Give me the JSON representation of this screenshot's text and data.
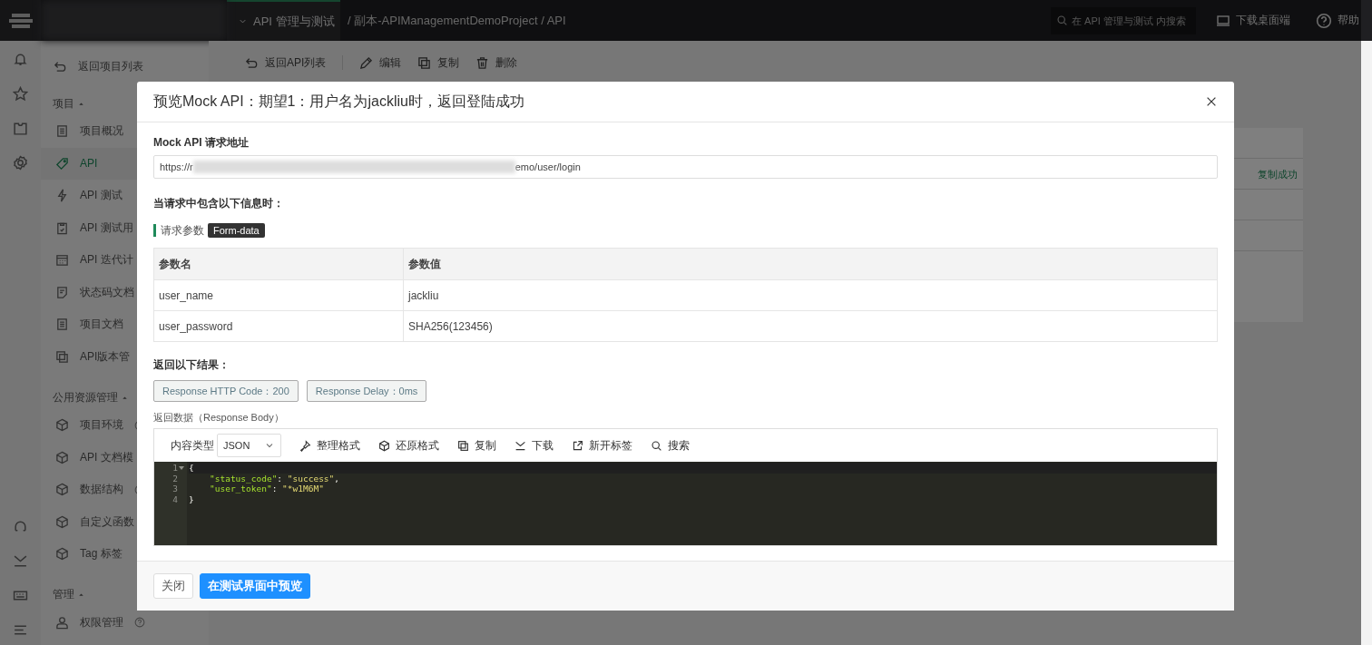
{
  "topbar": {
    "project_dropdown": "API 管理与测试",
    "breadcrumb": "/ 副本-APIManagementDemoProject / API",
    "search": {
      "placeholder": "在 API 管理与测试 内搜索"
    },
    "download": "下载桌面端",
    "help": "帮助"
  },
  "rail": [
    {
      "kind": "bell"
    },
    {
      "kind": "star"
    },
    {
      "kind": "shirt"
    },
    {
      "kind": "gear"
    }
  ],
  "rail_bottom": [
    {
      "kind": "headset"
    },
    {
      "kind": "download"
    },
    {
      "kind": "keyboard"
    },
    {
      "kind": "menu"
    }
  ],
  "sidebar": {
    "back": "返回项目列表",
    "groups": [
      {
        "title": "项目",
        "expanded": true,
        "items": [
          {
            "label": "项目概况",
            "kind": "doc",
            "selected": false,
            "info": false
          },
          {
            "label": "API",
            "kind": "tag",
            "selected": true,
            "info": false
          },
          {
            "label": "API 测试",
            "kind": "bolt",
            "selected": false,
            "info": false
          },
          {
            "label": "API 测试用",
            "kind": "clip",
            "selected": false,
            "info": false
          },
          {
            "label": "API 迭代计",
            "kind": "calendar",
            "selected": false,
            "info": false
          },
          {
            "label": "状态码文档",
            "kind": "note",
            "selected": false,
            "info": false
          },
          {
            "label": "项目文档",
            "kind": "doc",
            "selected": false,
            "info": false
          },
          {
            "label": "API版本管",
            "kind": "copy",
            "selected": false,
            "info": false
          }
        ]
      },
      {
        "title": "公用资源管理",
        "expanded": true,
        "items": [
          {
            "label": "项目环境",
            "kind": "cube",
            "selected": false,
            "info": true
          },
          {
            "label": "API 文档模",
            "kind": "cube",
            "selected": false,
            "info": false
          },
          {
            "label": "数据结构",
            "kind": "cube",
            "selected": false,
            "info": true
          },
          {
            "label": "自定义函数",
            "kind": "cube",
            "selected": false,
            "info": false
          },
          {
            "label": "Tag 标签",
            "kind": "cube",
            "selected": false,
            "info": false
          }
        ]
      },
      {
        "title": "管理",
        "expanded": true,
        "items": [
          {
            "label": "权限管理",
            "kind": "user",
            "selected": false,
            "info": true
          }
        ]
      }
    ]
  },
  "main_toolbar": [
    {
      "label": "返回API列表",
      "kind": "back"
    },
    {
      "label": "编辑",
      "kind": "edit"
    },
    {
      "label": "复制",
      "kind": "copy"
    },
    {
      "label": "删除",
      "kind": "trash"
    }
  ],
  "background_card": {
    "toast": "复制成功"
  },
  "modal": {
    "title": "预览Mock API：期望1：用户名为jackliu时，返回登陆成功",
    "url_label": "Mock API 请求地址",
    "url_start": "https://r",
    "url_end": "emo/user/login",
    "condition_heading": "当请求中包含以下信息时：",
    "params_label": "请求参数",
    "params_type": "Form-data",
    "table": {
      "columns": [
        "参数名",
        "参数值"
      ],
      "rows": [
        [
          "user_name",
          "jackliu"
        ],
        [
          "user_password",
          "SHA256(123456)"
        ]
      ]
    },
    "result_heading": "返回以下结果：",
    "result_tags": [
      "Response HTTP Code：200",
      "Response Delay：0ms"
    ],
    "body_label": "返回数据（Response Body）",
    "editor_toolbar": {
      "content_type_label": "内容类型",
      "content_type": "JSON",
      "actions": [
        {
          "label": "整理格式",
          "kind": "format"
        },
        {
          "label": "还原格式",
          "kind": "cube"
        },
        {
          "label": "复制",
          "kind": "copy"
        },
        {
          "label": "下载",
          "kind": "download"
        },
        {
          "label": "新开标签",
          "kind": "external"
        },
        {
          "label": "搜索",
          "kind": "search"
        }
      ]
    },
    "code": [
      {
        "number": "1",
        "fold": true,
        "indented": false,
        "tokens": [
          {
            "text": "{",
            "kind": "punct"
          }
        ]
      },
      {
        "number": "2",
        "fold": false,
        "indented": true,
        "tokens": [
          {
            "text": "\"status_code\"",
            "kind": "key"
          },
          {
            "text": ": ",
            "kind": "punct"
          },
          {
            "text": "\"success\"",
            "kind": "string"
          },
          {
            "text": ",",
            "kind": "punct"
          }
        ]
      },
      {
        "number": "3",
        "fold": false,
        "indented": true,
        "tokens": [
          {
            "text": "\"user_token\"",
            "kind": "key"
          },
          {
            "text": ": ",
            "kind": "punct"
          },
          {
            "text": "\"*w1M6M\"",
            "kind": "string"
          }
        ]
      },
      {
        "number": "4",
        "fold": false,
        "indented": false,
        "tokens": [
          {
            "text": "}",
            "kind": "punct"
          }
        ]
      }
    ],
    "buttons": [
      {
        "label": "关闭",
        "kind": "default"
      },
      {
        "label": "在测试界面中预览",
        "kind": "primary"
      }
    ]
  }
}
